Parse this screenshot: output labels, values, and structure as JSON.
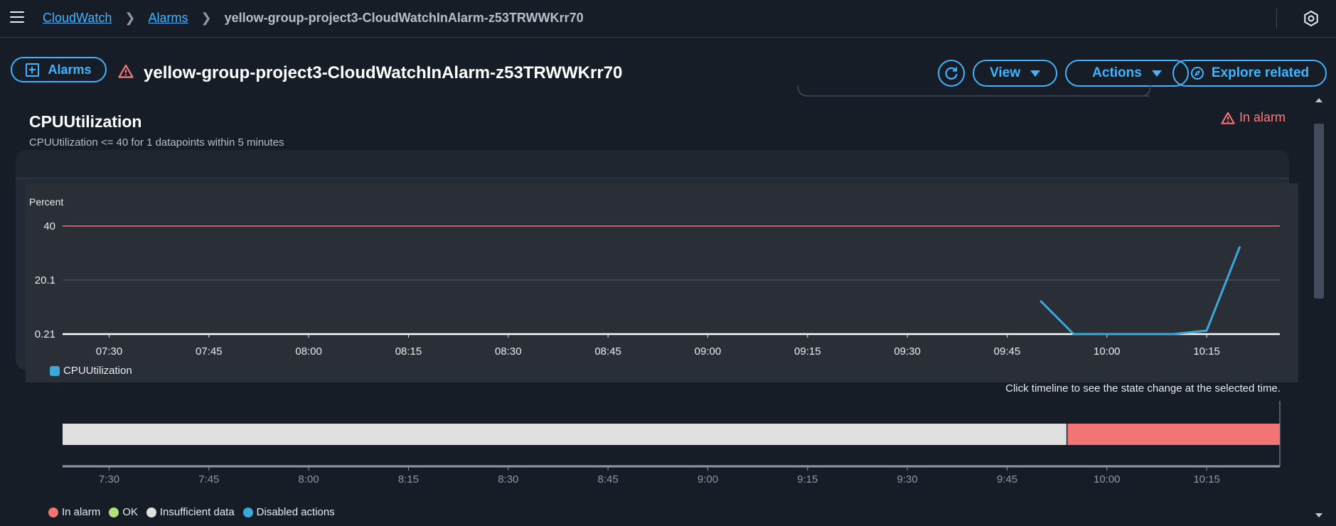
{
  "nav": {
    "breadcrumbs": [
      {
        "label": "CloudWatch"
      },
      {
        "label": "Alarms"
      },
      {
        "label": "yellow-group-project3-CloudWatchInAlarm-z53TRWWKrr70"
      }
    ]
  },
  "header": {
    "alarms_button": "Alarms",
    "title": "yellow-group-project3-CloudWatchInAlarm-z53TRWWKrr70",
    "view_button": "View",
    "actions_button": "Actions",
    "explore_button": "Explore related"
  },
  "metric": {
    "title": "CPUUtilization",
    "description": "CPUUtilization <= 40 for 1 datapoints within 5 minutes",
    "status": "In alarm",
    "y_unit": "Percent",
    "legend": "CPUUtilization"
  },
  "colors": {
    "accent": "#42b4ff",
    "alarm": "#ff7a7a",
    "series": "#3aa8d8",
    "threshold": "#f27474",
    "insufficient": "#e0e0e0",
    "ok": "#b0e17a"
  },
  "chart_data": {
    "type": "line",
    "ylabel": "Percent",
    "y_ticks": [
      "40",
      "20.1",
      "0.21"
    ],
    "y_tick_values": [
      40,
      20.1,
      0.21
    ],
    "ylim": [
      0.21,
      40
    ],
    "x_ticks": [
      "07:30",
      "07:45",
      "08:00",
      "08:15",
      "08:30",
      "08:45",
      "09:00",
      "09:15",
      "09:30",
      "09:45",
      "10:00",
      "10:15"
    ],
    "threshold": 40,
    "series": [
      {
        "name": "CPUUtilization",
        "x": [
          "09:50",
          "09:55",
          "10:00",
          "10:05",
          "10:10",
          "10:15",
          "10:20"
        ],
        "values": [
          12.5,
          0.21,
          0.21,
          0.21,
          0.21,
          1.5,
          32.5
        ]
      }
    ]
  },
  "timeline": {
    "hint": "Click timeline to see the state change at the selected time.",
    "x_ticks": [
      "7:30",
      "7:45",
      "8:00",
      "8:15",
      "8:30",
      "8:45",
      "9:00",
      "9:15",
      "9:30",
      "9:45",
      "10:00",
      "10:15"
    ],
    "segments": [
      {
        "state": "Insufficient data",
        "from": "07:23",
        "to": "09:54"
      },
      {
        "state": "In alarm",
        "from": "09:54",
        "to": "10:26"
      }
    ],
    "legend": [
      {
        "label": "In alarm",
        "color": "#f27474"
      },
      {
        "label": "OK",
        "color": "#b0e17a"
      },
      {
        "label": "Insufficient data",
        "color": "#e0e0e0"
      },
      {
        "label": "Disabled actions",
        "color": "#3aa8d8"
      }
    ]
  }
}
